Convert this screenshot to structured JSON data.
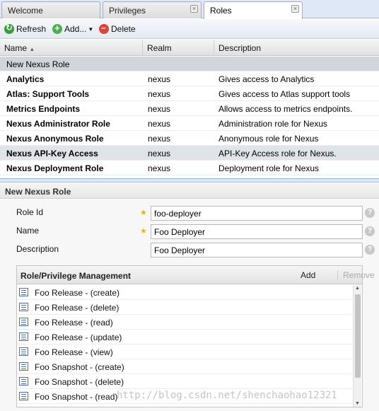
{
  "tabs": [
    {
      "label": "Welcome",
      "closable": false,
      "active": false
    },
    {
      "label": "Privileges",
      "closable": true,
      "active": false
    },
    {
      "label": "Roles",
      "closable": true,
      "active": true
    }
  ],
  "toolbar": {
    "refresh_label": "Refresh",
    "add_label": "Add...",
    "delete_label": "Delete"
  },
  "grid": {
    "columns": [
      "Name",
      "Realm",
      "Description"
    ],
    "new_row_label": "New Nexus Role",
    "rows": [
      {
        "name": "Analytics",
        "realm": "nexus",
        "description": "Gives access to Analytics"
      },
      {
        "name": "Atlas: Support Tools",
        "realm": "nexus",
        "description": "Gives access to Atlas support tools"
      },
      {
        "name": "Metrics Endpoints",
        "realm": "nexus",
        "description": "Allows access to metrics endpoints."
      },
      {
        "name": "Nexus Administrator Role",
        "realm": "nexus",
        "description": "Administration role for Nexus"
      },
      {
        "name": "Nexus Anonymous Role",
        "realm": "nexus",
        "description": "Anonymous role for Nexus"
      },
      {
        "name": "Nexus API-Key Access",
        "realm": "nexus",
        "description": "API-Key Access role for Nexus."
      },
      {
        "name": "Nexus Deployment Role",
        "realm": "nexus",
        "description": "Deployment role for Nexus"
      }
    ]
  },
  "form": {
    "title": "New Nexus Role",
    "role_id_label": "Role Id",
    "role_id_value": "foo-deployer",
    "name_label": "Name",
    "name_value": "Foo Deployer",
    "description_label": "Description",
    "description_value": "Foo Deployer",
    "help_glyph": "?",
    "required_glyph": "★"
  },
  "management": {
    "title": "Role/Privilege Management",
    "add_label": "Add",
    "remove_label": "Remove",
    "items": [
      "Foo Release - (create)",
      "Foo Release - (delete)",
      "Foo Release - (read)",
      "Foo Release - (update)",
      "Foo Release - (view)",
      "Foo Snapshot - (create)",
      "Foo Snapshot - (delete)",
      "Foo Snapshot - (read)"
    ]
  },
  "watermark": "http://blog.csdn.net/shenchaohao12321"
}
